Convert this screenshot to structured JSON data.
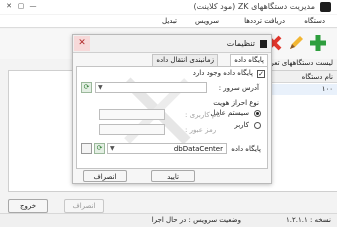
{
  "window": {
    "title": "مدیریت دستگاههای ZK (مود کلاینت)",
    "minimize": "—",
    "maximize": "▢",
    "close": "✕"
  },
  "menu": [
    "دستگاه",
    "دریافت ترددها",
    "سرویس",
    "تبدیل"
  ],
  "main": {
    "list_title": "لیست دستگاههای تعری",
    "column_header": "نام دستگاه",
    "row_value": "۱۰۰"
  },
  "buttons": {
    "cancel": "انصراف",
    "exit": "خروج"
  },
  "status": {
    "version": "نسخه : ۱.۲.۱.۱",
    "service_status": "وضعیت سرویس : در حال اجرا"
  },
  "dialog": {
    "title": "تنظیمات",
    "tabs": [
      "پایگاه داده",
      "زمانبندی انتقال داده"
    ],
    "db_exists_label": "پایگاه داده وجود دارد",
    "server_label": "آدرس سرور :",
    "server_value": "",
    "auth_label": "نوع احراز هویت",
    "auth_os": "سیستم عامل",
    "auth_user": "کاربر",
    "username_label": "نام کاربری :",
    "password_label": "رمز عبور :",
    "database_label": "پایگاه داده",
    "database_value": "dbDataCenter",
    "ok": "تایید",
    "cancel": "انصراف"
  },
  "colors": {
    "accent_green": "#2e9e3e",
    "delete_red": "#e0352b",
    "close_bg": "#f7d9d9"
  }
}
